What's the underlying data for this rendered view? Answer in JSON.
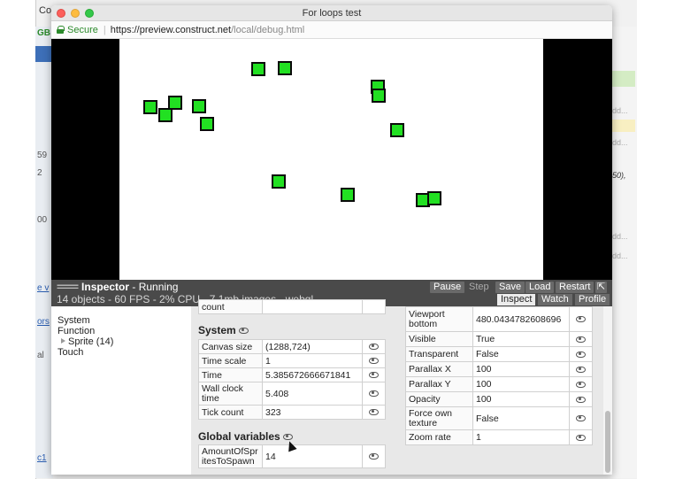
{
  "background": {
    "tab_label": "Co",
    "left_labels": [
      "GB",
      "59",
      "2",
      "00",
      "e v",
      "ors",
      "al",
      "c1"
    ],
    "right_items": [
      "dd...",
      "dd...",
      "50),",
      "dd...",
      "dd..."
    ]
  },
  "window": {
    "title": "For loops test",
    "secure_label": "Secure",
    "url_host": "https://preview.construct.net",
    "url_path": "/local/debug.html"
  },
  "inspector": {
    "dash": "====",
    "title": "Inspector",
    "state": "- Running",
    "stats": "14 objects - 60 FPS - 2% CPU - 7.1mb images - webgl",
    "buttons": {
      "pause": "Pause",
      "step": "Step",
      "save": "Save",
      "load": "Load",
      "restart": "Restart"
    },
    "tabs": {
      "inspect": "Inspect",
      "watch": "Watch",
      "profile": "Profile"
    }
  },
  "tree": {
    "system": "System",
    "function": "Function",
    "sprite": "Sprite (14)",
    "touch": "Touch"
  },
  "mid": {
    "partial_row_label": "count",
    "system_title": "System",
    "system_rows": [
      {
        "k": "Canvas size",
        "v": "(1288,724)"
      },
      {
        "k": "Time scale",
        "v": "1"
      },
      {
        "k": "Time",
        "v": "5.385672666671841"
      },
      {
        "k": "Wall clock time",
        "v": "5.408"
      },
      {
        "k": "Tick count",
        "v": "323"
      }
    ],
    "globals_title": "Global variables",
    "globals_rows": [
      {
        "k": "AmountOfSpritesToSpawn",
        "v": "14"
      }
    ]
  },
  "right": {
    "rows": [
      {
        "k": "Viewport bottom",
        "v": "480.0434782608696"
      },
      {
        "k": "Visible",
        "v": "True"
      },
      {
        "k": "Transparent",
        "v": "False"
      },
      {
        "k": "Parallax X",
        "v": "100"
      },
      {
        "k": "Parallax Y",
        "v": "100"
      },
      {
        "k": "Opacity",
        "v": "100"
      },
      {
        "k": "Force own texture",
        "v": "False"
      },
      {
        "k": "Zoom rate",
        "v": "1"
      }
    ]
  },
  "colors": {
    "sprite_fill": "#22e022",
    "inspector_bar": "#4a4a4a",
    "secure_green": "#2b8a2b"
  }
}
